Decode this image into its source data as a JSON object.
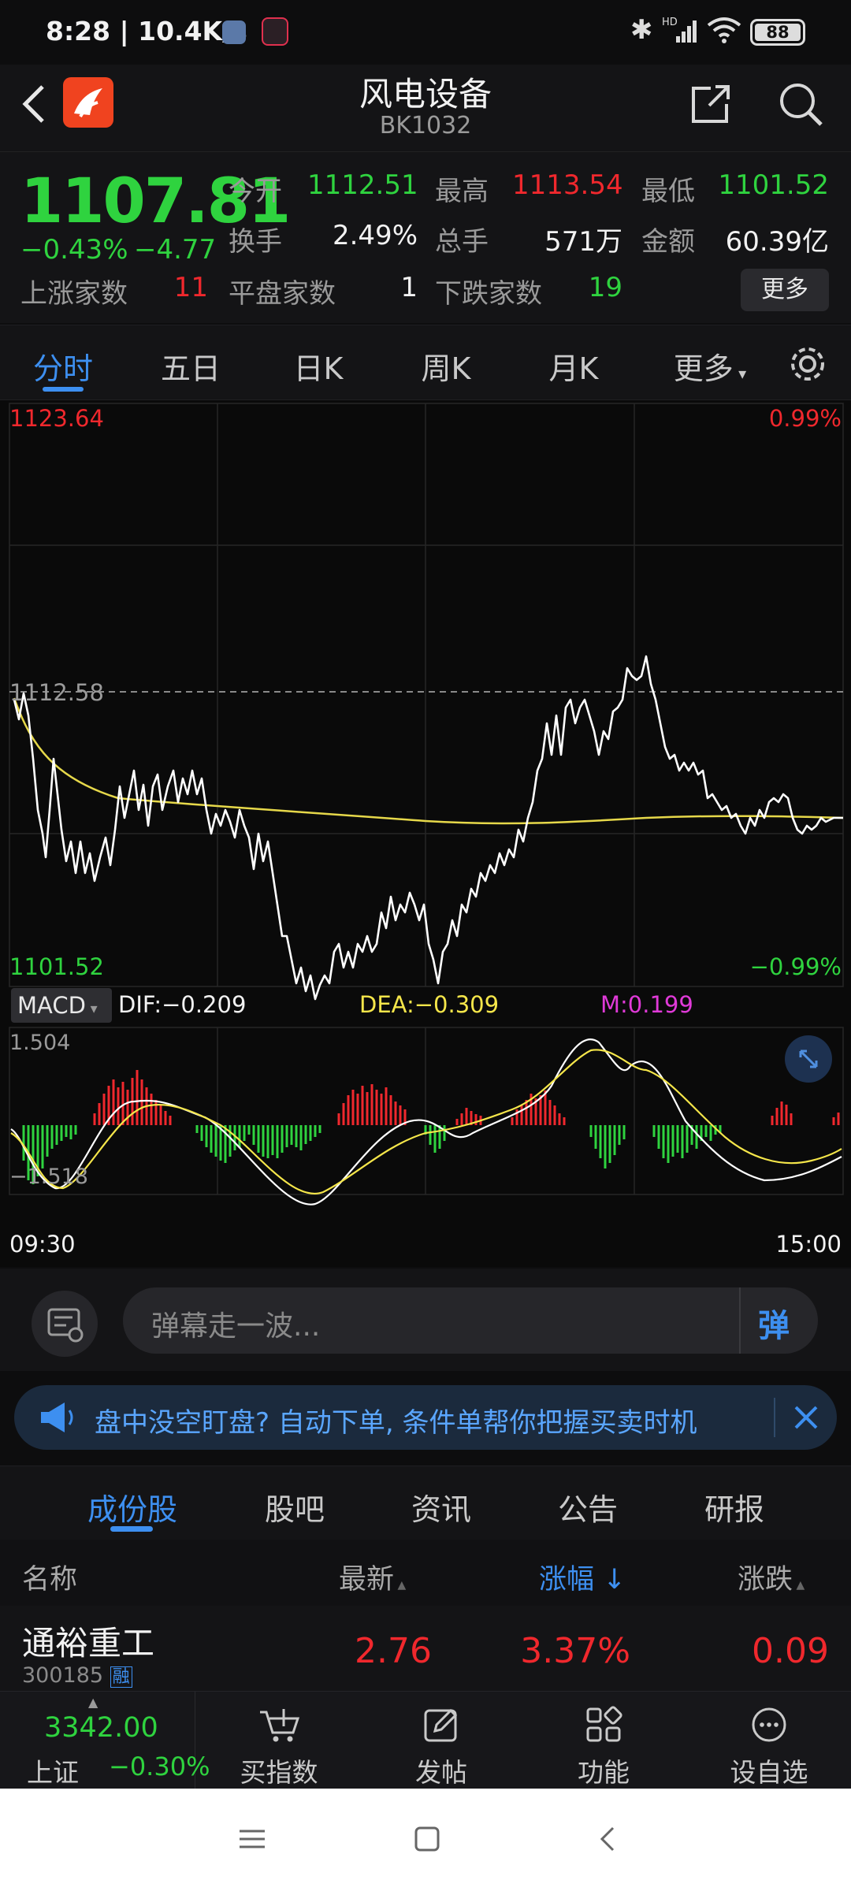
{
  "status_bar": {
    "time": "8:28",
    "speed": "10.4K/s",
    "network": "HD",
    "battery": "88"
  },
  "header": {
    "title": "风电设备",
    "code": "BK1032",
    "back_icon": "back-icon",
    "share_icon": "share-icon",
    "search_icon": "search-icon"
  },
  "quote": {
    "price": "1107.81",
    "change_pct": "−0.43%",
    "change_amt": "−4.77",
    "open_label": "今开",
    "open": "1112.51",
    "high_label": "最高",
    "high": "1113.54",
    "low_label": "最低",
    "low": "1101.52",
    "turnover_label": "换手",
    "turnover": "2.49%",
    "volume_label": "总手",
    "volume": "571万",
    "amount_label": "金额",
    "amount": "60.39亿",
    "up_label": "上涨家数",
    "up_count": "11",
    "flat_label": "平盘家数",
    "flat_count": "1",
    "down_label": "下跌家数",
    "down_count": "19",
    "more_button": "更多"
  },
  "period_tabs": [
    "分时",
    "五日",
    "日K",
    "周K",
    "月K",
    "更多"
  ],
  "chart": {
    "price_max": "1123.64",
    "price_ref": "1112.58",
    "price_min": "1101.52",
    "pct_max": "0.99%",
    "pct_min": "−0.99%",
    "macd_label": "MACD",
    "dif": "DIF:−0.209",
    "dea": "DEA:−0.309",
    "m": "M:0.199",
    "macd_max": "1.504",
    "macd_min": "−1.518",
    "time_start": "09:30",
    "time_end": "15:00",
    "colors": {
      "up": "#f0282d",
      "down": "#2fd33f",
      "avg_line": "#e6d84a",
      "price_line": "#ffffff",
      "dea": "#f5e64a",
      "m": "#e03ad8"
    }
  },
  "danmaku": {
    "placeholder": "弹幕走一波...",
    "send_label": "弹"
  },
  "banner": {
    "text": "盘中没空盯盘? 自动下单, 条件单帮你把握买卖时机"
  },
  "content_tabs": [
    "成份股",
    "股吧",
    "资讯",
    "公告",
    "研报"
  ],
  "table": {
    "headers": {
      "name": "名称",
      "latest": "最新",
      "change_pct": "涨幅",
      "change": "涨跌"
    },
    "rows": [
      {
        "name": "通裕重工",
        "code": "300185",
        "badge": "融",
        "latest": "2.76",
        "change_pct": "3.37%",
        "change": "0.09"
      }
    ]
  },
  "bottom_bar": {
    "index_value": "3342.00",
    "index_name": "上证",
    "index_change": "−0.30%",
    "items": [
      "买指数",
      "发帖",
      "功能",
      "设自选"
    ]
  }
}
